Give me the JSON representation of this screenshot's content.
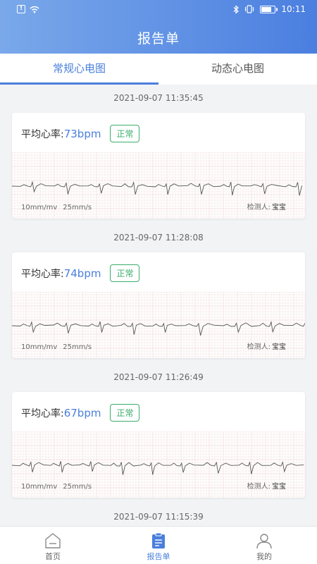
{
  "status_bar": {
    "time": "10:11"
  },
  "header": {
    "title": "报告单"
  },
  "tabs": [
    {
      "label": "常规心电图",
      "active": true
    },
    {
      "label": "动态心电图",
      "active": false
    }
  ],
  "reports": [
    {
      "datetime": "2021-09-07 11:35:45",
      "rate_label": "平均心率:",
      "rate_value": "73bpm",
      "status": "正常",
      "scale_amplitude": "10mm/mv",
      "scale_speed": "25mm/s",
      "inspector_label": "检测人:",
      "inspector": "宝宝"
    },
    {
      "datetime": "2021-09-07 11:28:08",
      "rate_label": "平均心率:",
      "rate_value": "74bpm",
      "status": "正常",
      "scale_amplitude": "10mm/mv",
      "scale_speed": "25mm/s",
      "inspector_label": "检测人:",
      "inspector": "宝宝"
    },
    {
      "datetime": "2021-09-07 11:26:49",
      "rate_label": "平均心率:",
      "rate_value": "67bpm",
      "status": "正常",
      "scale_amplitude": "10mm/mv",
      "scale_speed": "25mm/s",
      "inspector_label": "检测人:",
      "inspector": "宝宝"
    },
    {
      "datetime": "2021-09-07 11:15:39"
    }
  ],
  "bottom_nav": [
    {
      "label": "首页",
      "icon": "home-icon",
      "active": false
    },
    {
      "label": "报告单",
      "icon": "clipboard-icon",
      "active": true
    },
    {
      "label": "我的",
      "icon": "user-icon",
      "active": false
    }
  ],
  "colors": {
    "accent": "#4a7fdc",
    "normal": "#3aad6b",
    "grid": "#f0d4d4",
    "trace": "#555555"
  }
}
